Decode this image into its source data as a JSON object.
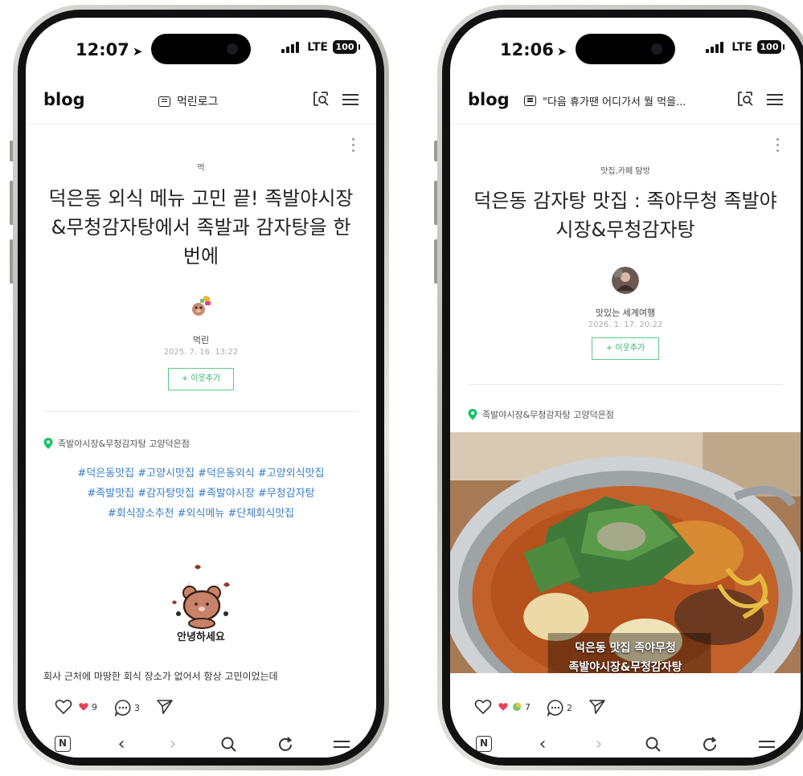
{
  "left_phone": {
    "status": {
      "time": "12:07",
      "network": "LTE",
      "battery": "100"
    },
    "header": {
      "logo": "blog",
      "board_name": "먹린로그"
    },
    "post": {
      "category": "먹",
      "title_lines": [
        "덕은동 외식 메뉴 고민 끝! 족발야시장",
        "&무청감자탕에서 족발과 감자탕을 한",
        "번에"
      ],
      "author": "먹린",
      "date": "2025. 7. 16. 13:22",
      "add_neighbor_label": "+ 이웃추가",
      "place": "족발야시장&무청감자탕 고양덕은점",
      "hashtag_lines": [
        "#덕은동맛집 #고양시맛집 #덕은동외식 #고양외식맛집",
        "#족발맛집 #감자탕맛집 #족발야시장 #무청감자탕",
        "#회식장소추천 #외식메뉴 #단체회식맛집"
      ],
      "sticker_text": "안녕하세요",
      "body_preview": "회사 근처에 마땅한 회식 장소가 없어서 항상 고민이었는데"
    },
    "actions": {
      "like_count": "9",
      "comment_count": "3"
    }
  },
  "right_phone": {
    "status": {
      "time": "12:06",
      "network": "LTE",
      "battery": "100"
    },
    "header": {
      "logo": "blog",
      "board_name": "\"다음 휴가땐 어디가서 뭘 먹을..."
    },
    "post": {
      "category": "맛집,카페 탐방",
      "title_lines": [
        "덕은동 감자탕 맛집 : 족야무청 족발야",
        "시장&무청감자탕"
      ],
      "author": "맛있는 세계여행",
      "date": "2026. 1. 17. 20:22",
      "add_neighbor_label": "+ 이웃추가",
      "place": "족발야시장&무청감자탕 고양덕은점",
      "photo_caption_lines": [
        "덕은동 맛집 족야무청",
        "족발야시장&무청감자탕"
      ]
    },
    "actions": {
      "like_count": "7",
      "comment_count": "2"
    }
  },
  "colors": {
    "accent_green": "#2db36b",
    "hashtag_blue": "#3a7ec9",
    "pin_green": "#19c463"
  },
  "icons": [
    "location-arrow-icon",
    "signal-icon",
    "battery-icon",
    "board-icon",
    "search-document-icon",
    "menu-icon",
    "more-vertical-icon",
    "pin-icon",
    "heart-outline-icon",
    "heart-filled-icon",
    "comment-icon",
    "share-icon",
    "naver-n-icon",
    "back-icon",
    "forward-icon",
    "search-icon",
    "refresh-icon",
    "nav-menu-icon"
  ]
}
